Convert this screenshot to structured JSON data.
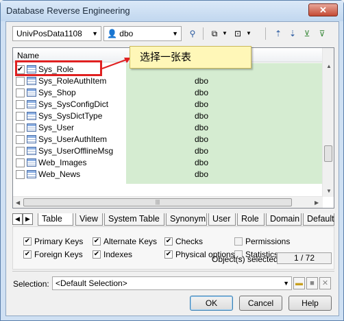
{
  "window": {
    "title": "Database Reverse Engineering",
    "close_glyph": "✕"
  },
  "toolbar": {
    "database": "UnivPosData1108",
    "owner": "dbo",
    "icons": [
      "owner-filter-icon",
      "select-all-icon",
      "deselect-icon",
      "move-up-icon",
      "move-down-icon",
      "filter-icon",
      "filter-clear-icon"
    ]
  },
  "list": {
    "header_name": "Name",
    "rows": [
      {
        "name": "Sys_Role",
        "owner": "",
        "checked": true
      },
      {
        "name": "Sys_RoleAuthItem",
        "owner": "dbo",
        "checked": false
      },
      {
        "name": "Sys_Shop",
        "owner": "dbo",
        "checked": false
      },
      {
        "name": "Sys_SysConfigDict",
        "owner": "dbo",
        "checked": false
      },
      {
        "name": "Sys_SysDictType",
        "owner": "dbo",
        "checked": false
      },
      {
        "name": "Sys_User",
        "owner": "dbo",
        "checked": false
      },
      {
        "name": "Sys_UserAuthItem",
        "owner": "dbo",
        "checked": false
      },
      {
        "name": "Sys_UserOfflineMsg",
        "owner": "dbo",
        "checked": false
      },
      {
        "name": "Web_Images",
        "owner": "dbo",
        "checked": false
      },
      {
        "name": "Web_News",
        "owner": "dbo",
        "checked": false
      }
    ],
    "highlight_color": "#d5ecd1"
  },
  "annotation": {
    "callout_text": "选择一张表",
    "accent": "#e02020"
  },
  "tabs": [
    "Table",
    "View",
    "System Table",
    "Synonym",
    "User",
    "Role",
    "Domain",
    "Default"
  ],
  "options": {
    "primary_keys": "Primary Keys",
    "alternate_keys": "Alternate Keys",
    "checks": "Checks",
    "permissions": "Permissions",
    "foreign_keys": "Foreign Keys",
    "indexes": "Indexes",
    "physical_options": "Physical options",
    "statistics": "Statistics"
  },
  "status": {
    "label": "Object(s) selected:",
    "value": "1 / 72"
  },
  "selection": {
    "label": "Selection:",
    "value": "<Default Selection>"
  },
  "buttons": {
    "ok": "OK",
    "cancel": "Cancel",
    "help": "Help"
  }
}
